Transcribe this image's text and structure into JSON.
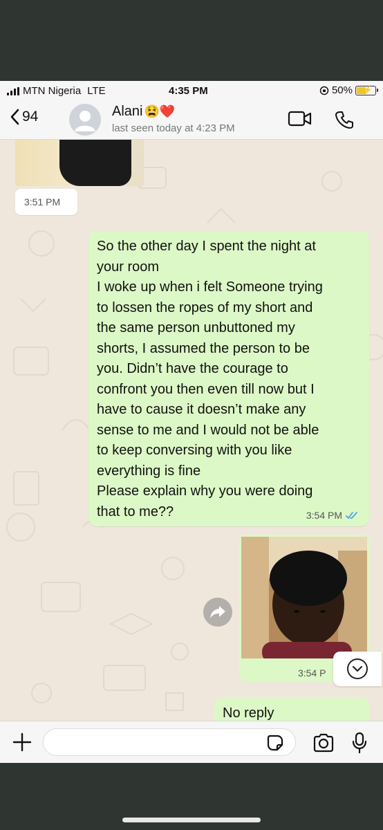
{
  "status_bar": {
    "carrier": "MTN Nigeria",
    "network": "LTE",
    "time": "4:35 PM",
    "battery": "50%",
    "battery_level": 0.5
  },
  "header": {
    "back_count": "94",
    "contact_name": "Alani",
    "contact_emojis": "😫❤️",
    "last_seen": "last seen today at 4:23 PM"
  },
  "messages": [
    {
      "type": "image",
      "direction": "incoming",
      "time": "3:51 PM"
    },
    {
      "type": "text",
      "direction": "outgoing",
      "text": "So the other day I spent the night at\nyour room\nI woke up when i felt Someone trying\nto lossen the ropes of my short and\nthe same person unbuttoned my\nshorts,  I assumed the person to be\nyou. Didn’t have the courage to\nconfront you then even till now but I\nhave to cause it doesn’t make any\nsense to me and I would not be able\nto keep conversing with you like\neverything is fine\nPlease explain why you were doing\nthat to me??",
      "time": "3:54 PM",
      "status": "read"
    },
    {
      "type": "image",
      "direction": "outgoing",
      "time": "3:54 P"
    },
    {
      "type": "text",
      "direction": "outgoing",
      "text": "No reply"
    }
  ],
  "input": {
    "placeholder": "",
    "value": ""
  },
  "colors": {
    "chat_bg": "#efe7dc",
    "outgoing_bubble": "#dcf8c6",
    "incoming_bubble": "#ffffff",
    "read_ticks": "#4fa3e0",
    "ios_blue": "#007aff"
  },
  "icons": [
    "back-chevron-icon",
    "video-call-icon",
    "phone-icon",
    "forward-icon",
    "chevron-down-icon",
    "plus-icon",
    "sticker-icon",
    "camera-icon",
    "mic-icon"
  ]
}
